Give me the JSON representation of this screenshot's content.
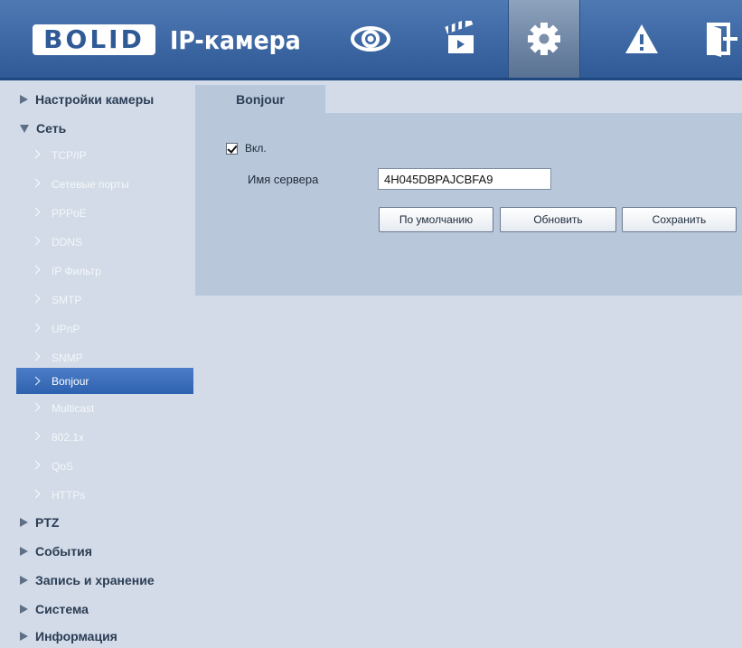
{
  "header": {
    "logo_text": "BOLID",
    "app_title": "IP-камера",
    "nav": [
      {
        "icon": "eye-icon"
      },
      {
        "icon": "clapperboard-icon"
      },
      {
        "icon": "gear-icon",
        "active": true
      },
      {
        "icon": "warning-icon"
      },
      {
        "icon": "exit-icon"
      }
    ]
  },
  "sidebar": {
    "groups": [
      {
        "label": "Настройки камеры",
        "expanded": false
      },
      {
        "label": "Сеть",
        "expanded": true
      },
      {
        "label": "PTZ",
        "expanded": false
      },
      {
        "label": "События",
        "expanded": false
      },
      {
        "label": "Запись и хранение",
        "expanded": false
      },
      {
        "label": "Система",
        "expanded": false
      },
      {
        "label": "Информация",
        "expanded": false
      }
    ],
    "network_items": [
      "TCP/IP",
      "Сетевые порты",
      "PPPoE",
      "DDNS",
      "IP Фильтр",
      "SMTP",
      "UPnP",
      "SNMP",
      "Bonjour",
      "Multicast",
      "802.1x",
      "QoS",
      "HTTPs"
    ],
    "active_item": "Bonjour"
  },
  "content": {
    "tab_label": "Bonjour",
    "enable_label": "Вкл.",
    "enable_checked": true,
    "server_name_label": "Имя сервера",
    "server_name_value": "4H045DBPAJCBFA9",
    "buttons": {
      "default": "По умолчанию",
      "refresh": "Обновить",
      "save": "Сохранить"
    }
  },
  "colors": {
    "header": "#3b66a2",
    "sidebar_bg": "#d2dbe7",
    "panel_bg": "#b9c7da",
    "active_item": "#3b6fba"
  }
}
